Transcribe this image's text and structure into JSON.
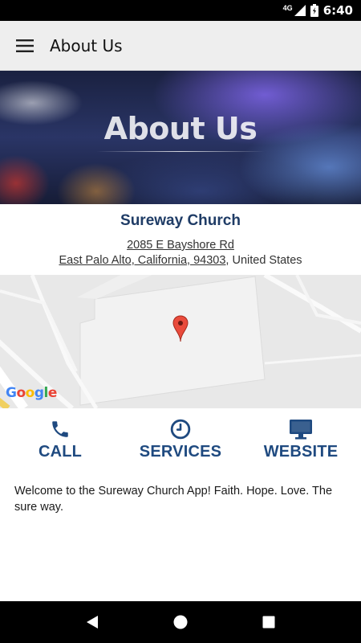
{
  "status_bar": {
    "network": "4G",
    "time": "6:40"
  },
  "app_bar": {
    "title": "About Us",
    "menu_icon": "hamburger-menu-icon"
  },
  "hero": {
    "title": "About Us"
  },
  "church": {
    "name": "Sureway Church",
    "address_line1": "2085 E Bayshore Rd",
    "address_line2": "East Palo Alto, California, 94303",
    "country": ", United States"
  },
  "map": {
    "attribution": "Google",
    "marker_icon": "map-pin-icon"
  },
  "actions": [
    {
      "label": "CALL",
      "icon": "phone-icon"
    },
    {
      "label": "SERVICES",
      "icon": "clock-icon"
    },
    {
      "label": "WEBSITE",
      "icon": "monitor-icon"
    }
  ],
  "welcome_text": "Welcome to the Sureway Church App! Faith. Hope. Love. The sure way.",
  "colors": {
    "accent": "#1f4a80",
    "title": "#1f3c66",
    "app_bar": "#eeeeee"
  }
}
